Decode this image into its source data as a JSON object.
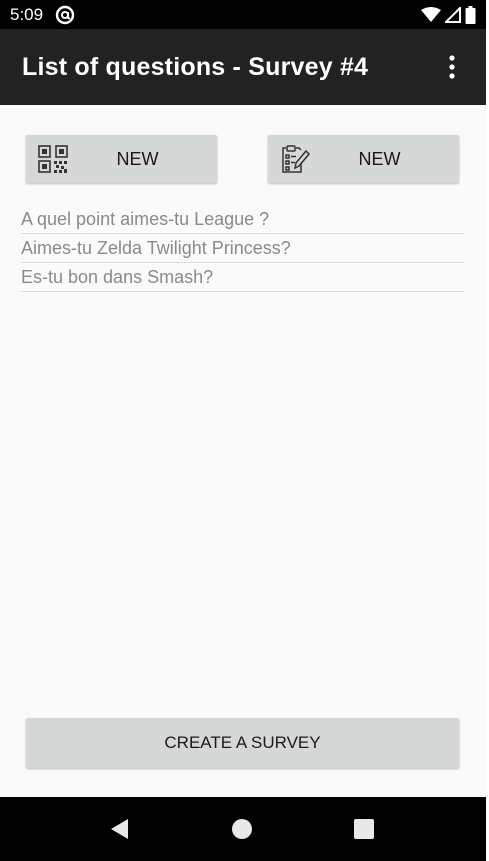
{
  "status_bar": {
    "time": "5:09",
    "left_icon": "at-sign-icon",
    "right_icons": [
      "wifi-icon",
      "signal-icon",
      "battery-icon"
    ]
  },
  "toolbar": {
    "title": "List of questions - Survey #4",
    "overflow_icon": "more-vert-icon"
  },
  "actions": {
    "new_qr_label": "NEW",
    "new_qr_icon": "qr-code-icon",
    "new_form_label": "NEW",
    "new_form_icon": "clipboard-edit-icon"
  },
  "questions": [
    "A quel point aimes-tu League ?",
    "Aimes-tu Zelda Twilight Princess?",
    "Es-tu bon dans Smash?"
  ],
  "create_button_label": "CREATE A SURVEY",
  "nav_bar": {
    "icons": [
      "back-icon",
      "home-icon",
      "recents-icon"
    ]
  },
  "colors": {
    "toolbar": "#222222",
    "background": "#fafafa",
    "button": "#d6d7d7",
    "question_text": "#8a8a8a"
  }
}
